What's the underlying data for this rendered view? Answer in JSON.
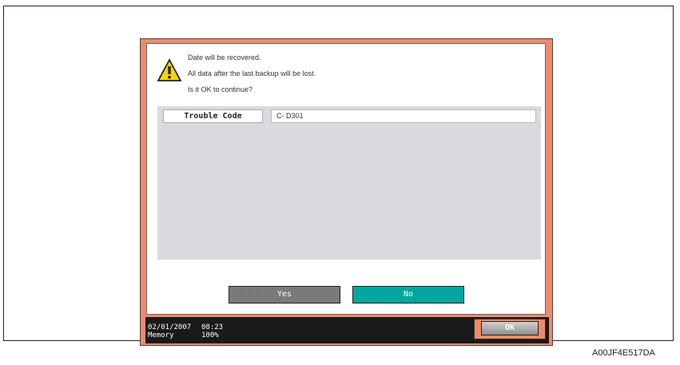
{
  "dialog": {
    "message_lines": [
      "Date will be recovered.",
      "All data after the last backup will be lost.",
      "Is it OK to continue?"
    ],
    "trouble_code_label": "Trouble Code",
    "trouble_code_value": "C- D301",
    "yes_label": "Yes",
    "no_label": "No"
  },
  "status": {
    "date": "02/01/2007",
    "time": "08:23",
    "memory_label": "Memory",
    "memory_value": "100%",
    "ok_label": "OK"
  },
  "caption": "A00JF4E517DA",
  "icons": {
    "warning": "warning-triangle-icon"
  },
  "colors": {
    "frame_accent": "#f08a6a",
    "no_button": "#00a6a0",
    "status_bar": "#1a1a1a"
  }
}
